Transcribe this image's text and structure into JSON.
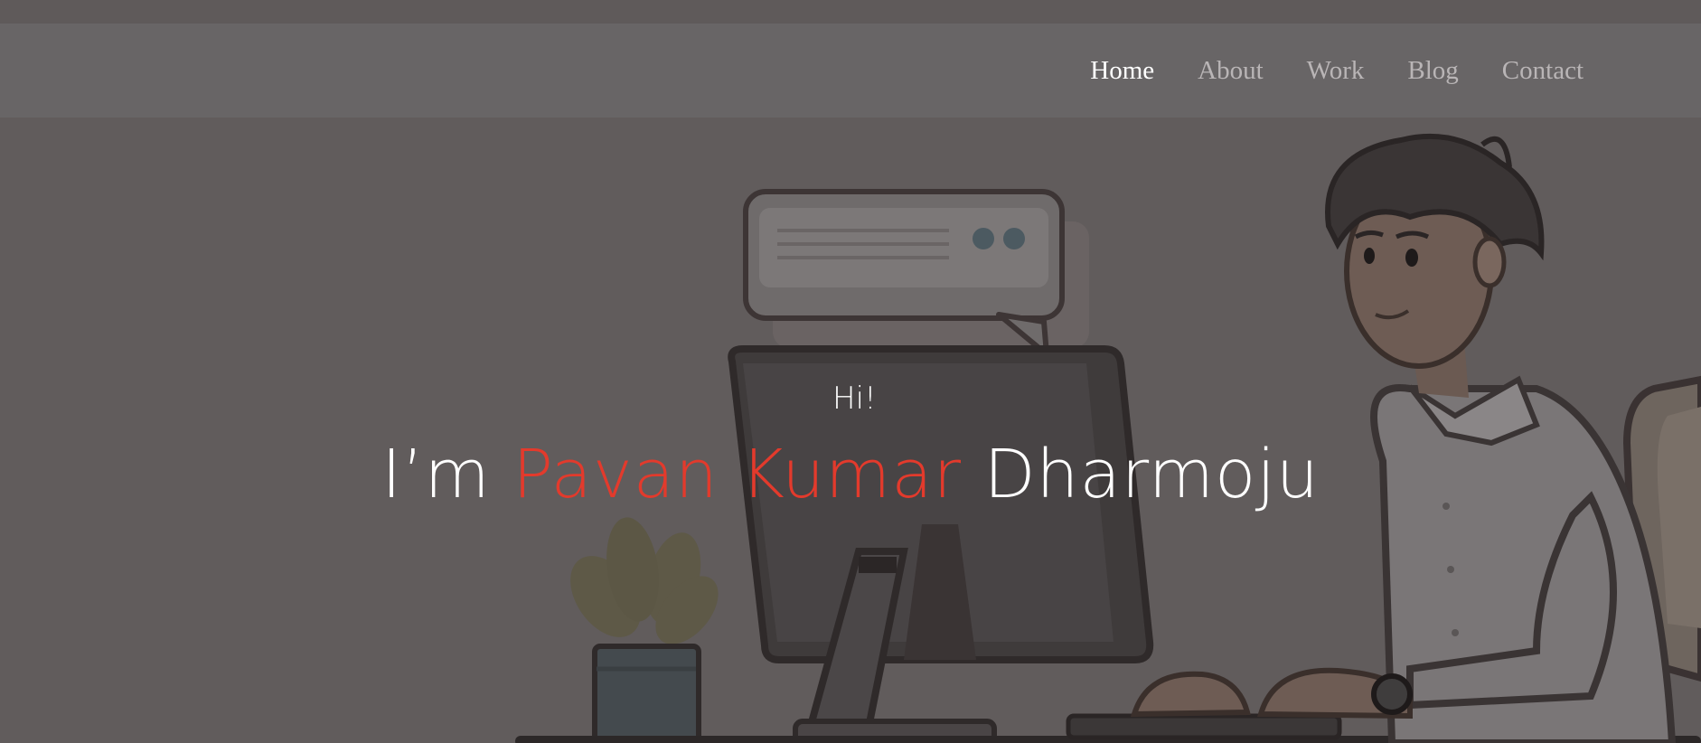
{
  "nav": {
    "items": [
      {
        "label": "Home",
        "active": true
      },
      {
        "label": "About",
        "active": false
      },
      {
        "label": "Work",
        "active": false
      },
      {
        "label": "Blog",
        "active": false
      },
      {
        "label": "Contact",
        "active": false
      }
    ]
  },
  "hero": {
    "greeting": "Hi!",
    "intro_prefix": "I’m",
    "name_highlight": "Pavan Kumar",
    "name_rest": "Dharmoju"
  },
  "colors": {
    "background_overlay": "#615c5c",
    "navbar": "#686566",
    "accent_red": "#e33a2c",
    "nav_active": "#ffffff",
    "nav_inactive": "#b9b5b6"
  },
  "icons": {
    "illustration": "developer-at-desk-illustration"
  }
}
